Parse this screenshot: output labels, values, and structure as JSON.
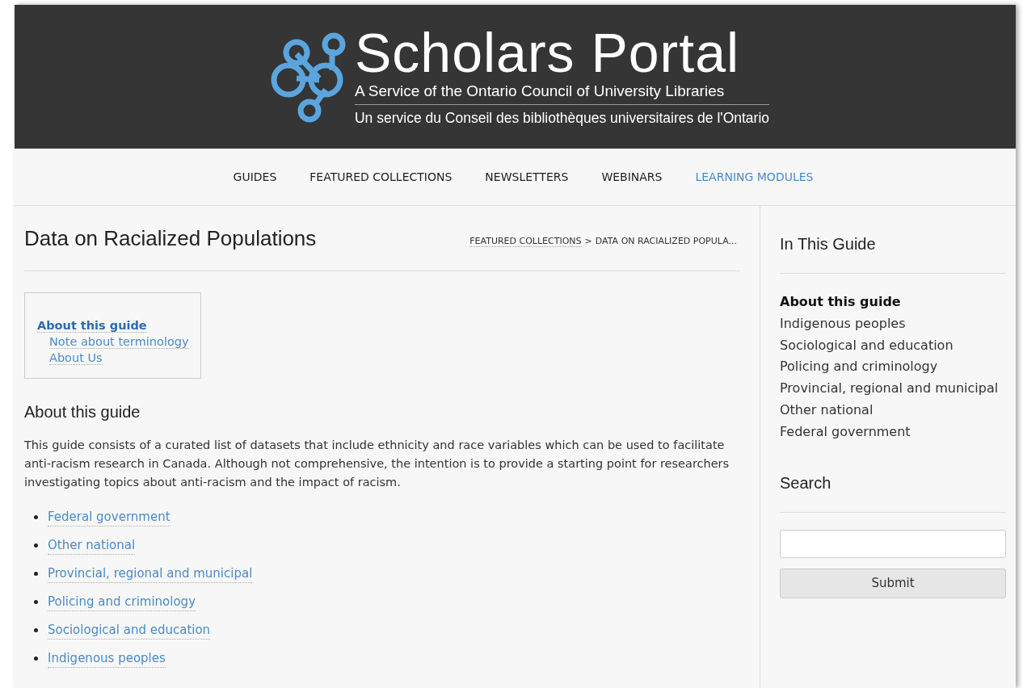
{
  "header": {
    "title": "Scholars Portal",
    "subtitle_en": "A Service of the Ontario Council of University Libraries",
    "subtitle_fr": "Un service du Conseil des bibliothèques universitaires de l'Ontario"
  },
  "nav": [
    {
      "label": "GUIDES",
      "selected": false
    },
    {
      "label": "FEATURED COLLECTIONS",
      "selected": false
    },
    {
      "label": "NEWSLETTERS",
      "selected": false
    },
    {
      "label": "WEBINARS",
      "selected": false
    },
    {
      "label": "LEARNING MODULES",
      "selected": true
    }
  ],
  "page_title": "Data on Racialized Populations",
  "breadcrumb": {
    "link": "FEATURED COLLECTIONS",
    "separator": ">",
    "current": "DATA ON RACIALIZED POPULA..."
  },
  "toc": [
    {
      "label": "About this guide",
      "children": [
        {
          "label": "Note about terminology"
        },
        {
          "label": "About Us"
        }
      ]
    }
  ],
  "section_heading": "About this guide",
  "intro": "This guide consists of a curated list of datasets that include ethnicity and race variables which can be used to facilitate anti-racism research in Canada. Although not comprehensive, the intention is to provide a starting point for researchers investigating topics about anti-racism and the impact of racism.",
  "links": [
    "Federal government",
    "Other national",
    "Provincial, regional and municipal",
    "Policing and criminology",
    "Sociological and education",
    "Indigenous peoples"
  ],
  "sidebar": {
    "heading": "In This Guide",
    "items": [
      {
        "label": "About this guide",
        "selected": true
      },
      {
        "label": "Indigenous peoples",
        "selected": false
      },
      {
        "label": "Sociological and education",
        "selected": false
      },
      {
        "label": "Policing and criminology",
        "selected": false
      },
      {
        "label": "Provincial, regional and municipal",
        "selected": false
      },
      {
        "label": "Other national",
        "selected": false
      },
      {
        "label": "Federal government",
        "selected": false
      }
    ],
    "search_heading": "Search",
    "submit": "Submit"
  }
}
